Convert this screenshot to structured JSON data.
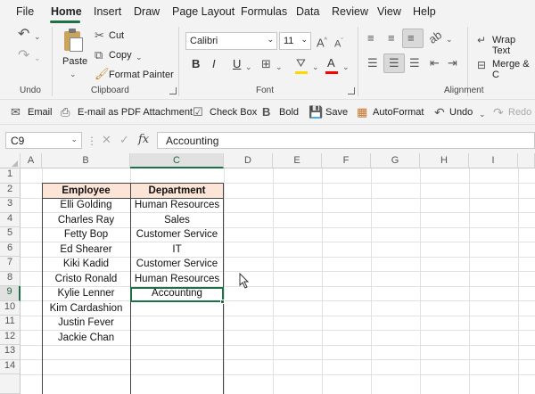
{
  "menu": {
    "tabs": [
      "File",
      "Home",
      "Insert",
      "Draw",
      "Page Layout",
      "Formulas",
      "Data",
      "Review",
      "View",
      "Help"
    ]
  },
  "ribbon": {
    "undo_group": "Undo",
    "clipboard": {
      "paste": "Paste",
      "cut": "Cut",
      "copy": "Copy",
      "format_painter": "Format Painter",
      "label": "Clipboard"
    },
    "font": {
      "name": "Calibri",
      "size": "11",
      "bold": "B",
      "italic": "I",
      "underline": "U",
      "font_color_glyph": "A",
      "label": "Font"
    },
    "alignment": {
      "wrap_text": "Wrap Text",
      "merge": "Merge & C",
      "label": "Alignment"
    }
  },
  "quick_toolbar": {
    "email": "Email",
    "pdf": "E-mail as PDF Attachment",
    "checkbox": "Check Box",
    "bold": "Bold",
    "save": "Save",
    "autoformat": "AutoFormat",
    "undo": "Undo",
    "redo": "Redo"
  },
  "formula_bar": {
    "name_box": "C9",
    "fx": "fx",
    "value": "Accounting"
  },
  "sheet": {
    "columns": [
      "A",
      "B",
      "C",
      "D",
      "E",
      "F",
      "G",
      "H",
      "I"
    ],
    "selected_column": "C",
    "rows": [
      "1",
      "2",
      "3",
      "4",
      "5",
      "6",
      "7",
      "8",
      "9",
      "10",
      "11",
      "12",
      "13",
      "14"
    ],
    "selected_row": "9",
    "header": {
      "employee": "Employee",
      "department": "Department"
    },
    "employees": [
      "Elli Golding",
      "Charles Ray",
      "Fetty Bop",
      "Ed Shearer",
      "Kiki Kadid",
      "Cristo Ronald",
      "Kylie Lenner",
      "Kim Cardashion",
      "Justin Fever",
      "Jackie Chan"
    ],
    "departments": [
      "Human Resources",
      "Sales",
      "Customer Service",
      "IT",
      "Customer Service",
      "Human Resources",
      "Accounting"
    ],
    "colors": {
      "header_fill": "#fce4d6",
      "selection": "#1e7145"
    }
  }
}
